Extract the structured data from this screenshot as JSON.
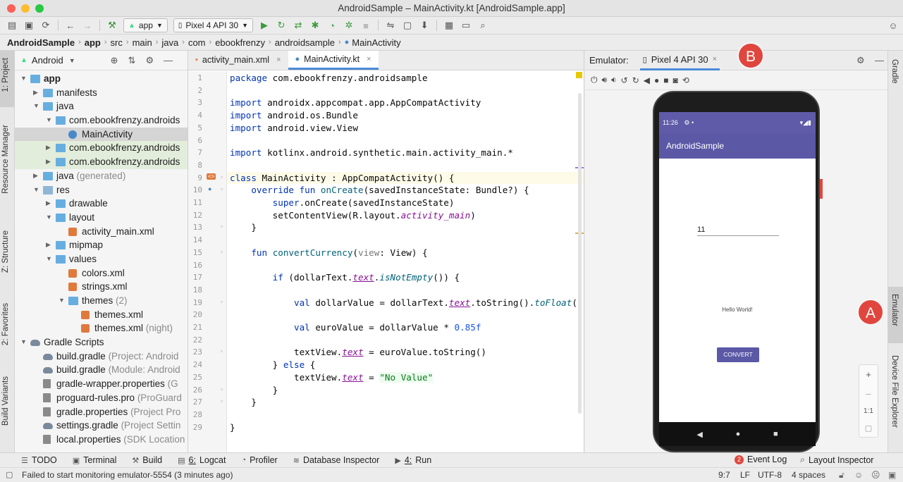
{
  "window": {
    "title": "AndroidSample – MainActivity.kt [AndroidSample.app]"
  },
  "toolbar": {
    "run_config": "app",
    "device": "Pixel 4 API 30",
    "icons": [
      "open-icon",
      "save-icon",
      "sync-icon",
      "back-icon",
      "forward-icon",
      "build-icon",
      "run-icon",
      "apply-changes-icon",
      "apply-code-changes-icon",
      "debug-icon",
      "profile-icon",
      "attach-debugger-icon",
      "stop-icon",
      "gradle-sync-icon",
      "avd-manager-icon",
      "sdk-manager-icon",
      "project-structure-icon",
      "search-icon",
      "user-icon"
    ]
  },
  "breadcrumbs": [
    "AndroidSample",
    "app",
    "src",
    "main",
    "java",
    "com",
    "ebookfrenzy",
    "androidsample",
    "MainActivity"
  ],
  "left_strip": [
    "1: Project",
    "Resource Manager",
    "Z: Structure",
    "2: Favorites",
    "Build Variants"
  ],
  "right_strip": [
    "Gradle",
    "Emulator",
    "Device File Explorer"
  ],
  "project": {
    "view": "Android",
    "tree": [
      {
        "label": "app",
        "extra": "",
        "depth": 0,
        "icon": "folder",
        "open": true
      },
      {
        "label": "manifests",
        "extra": "",
        "depth": 1,
        "icon": "folder",
        "open": false
      },
      {
        "label": "java",
        "extra": "",
        "depth": 1,
        "icon": "folder",
        "open": true
      },
      {
        "label": "com.ebookfrenzy.androids",
        "extra": "",
        "depth": 2,
        "icon": "folder",
        "open": true
      },
      {
        "label": "MainActivity",
        "extra": "",
        "depth": 3,
        "icon": "kotlin",
        "open": null
      },
      {
        "label": "com.ebookfrenzy.androids",
        "extra": "",
        "depth": 2,
        "icon": "folder",
        "open": false
      },
      {
        "label": "com.ebookfrenzy.androids",
        "extra": "",
        "depth": 2,
        "icon": "folder",
        "open": false
      },
      {
        "label": "java",
        "extra": "(generated)",
        "depth": 1,
        "icon": "folder",
        "open": false
      },
      {
        "label": "res",
        "extra": "",
        "depth": 1,
        "icon": "res",
        "open": true
      },
      {
        "label": "drawable",
        "extra": "",
        "depth": 2,
        "icon": "folder",
        "open": false
      },
      {
        "label": "layout",
        "extra": "",
        "depth": 2,
        "icon": "folder",
        "open": true
      },
      {
        "label": "activity_main.xml",
        "extra": "",
        "depth": 3,
        "icon": "xml",
        "open": null
      },
      {
        "label": "mipmap",
        "extra": "",
        "depth": 2,
        "icon": "folder",
        "open": false
      },
      {
        "label": "values",
        "extra": "",
        "depth": 2,
        "icon": "folder",
        "open": true
      },
      {
        "label": "colors.xml",
        "extra": "",
        "depth": 3,
        "icon": "xml",
        "open": null
      },
      {
        "label": "strings.xml",
        "extra": "",
        "depth": 3,
        "icon": "xml",
        "open": null
      },
      {
        "label": "themes",
        "extra": "(2)",
        "depth": 3,
        "icon": "folder",
        "open": true
      },
      {
        "label": "themes.xml",
        "extra": "",
        "depth": 4,
        "icon": "xml",
        "open": null
      },
      {
        "label": "themes.xml",
        "extra": "(night)",
        "depth": 4,
        "icon": "xml",
        "open": null
      },
      {
        "label": "Gradle Scripts",
        "extra": "",
        "depth": 0,
        "icon": "gradle",
        "open": true
      },
      {
        "label": "build.gradle",
        "extra": "(Project: Android",
        "depth": 1,
        "icon": "gradle",
        "open": null
      },
      {
        "label": "build.gradle",
        "extra": "(Module: Android",
        "depth": 1,
        "icon": "gradle",
        "open": null
      },
      {
        "label": "gradle-wrapper.properties",
        "extra": "(G",
        "depth": 1,
        "icon": "prop",
        "open": null
      },
      {
        "label": "proguard-rules.pro",
        "extra": "(ProGuard",
        "depth": 1,
        "icon": "prop",
        "open": null
      },
      {
        "label": "gradle.properties",
        "extra": "(Project Pro",
        "depth": 1,
        "icon": "prop",
        "open": null
      },
      {
        "label": "settings.gradle",
        "extra": "(Project Settin",
        "depth": 1,
        "icon": "gradle",
        "open": null
      },
      {
        "label": "local.properties",
        "extra": "(SDK Location",
        "depth": 1,
        "icon": "prop",
        "open": null
      }
    ]
  },
  "editor": {
    "tabs": [
      {
        "label": "activity_main.xml",
        "close": "×",
        "active": false
      },
      {
        "label": "MainActivity.kt",
        "close": "×",
        "active": true
      }
    ],
    "line_numbers": [
      "1",
      "2",
      "3",
      "4",
      "5",
      "6",
      "7",
      "8",
      "9",
      "10",
      "11",
      "12",
      "13",
      "14",
      "15",
      "16",
      "17",
      "18",
      "19",
      "20",
      "21",
      "22",
      "23",
      "24",
      "25",
      "26",
      "27",
      "28",
      "29"
    ],
    "lines": [
      [
        [
          "kw",
          "package "
        ],
        [
          "",
          "com.ebookfrenzy.androidsample"
        ]
      ],
      [],
      [
        [
          "kw",
          "import "
        ],
        [
          "",
          "androidx.appcompat.app.AppCompatActivity"
        ]
      ],
      [
        [
          "kw",
          "import "
        ],
        [
          "",
          "android.os.Bundle"
        ]
      ],
      [
        [
          "kw",
          "import "
        ],
        [
          "",
          "android.view.View"
        ]
      ],
      [],
      [
        [
          "kw",
          "import "
        ],
        [
          "",
          "kotlinx.android.synthetic.main.activity_main.*"
        ]
      ],
      [],
      [
        [
          "kw",
          "class "
        ],
        [
          "",
          "MainActivity : AppCompatActivity() {"
        ]
      ],
      [
        [
          "",
          "    "
        ],
        [
          "kw",
          "override fun "
        ],
        [
          "fnd",
          "onCreate"
        ],
        [
          "",
          "(savedInstanceState: Bundle?) {"
        ]
      ],
      [
        [
          "",
          "        "
        ],
        [
          "kw",
          "super"
        ],
        [
          "",
          ".onCreate(savedInstanceState)"
        ]
      ],
      [
        [
          "",
          "        setContentView(R.layout."
        ],
        [
          "prop it",
          "activity_main"
        ],
        [
          "",
          ")"
        ]
      ],
      [
        [
          "",
          "    }"
        ]
      ],
      [],
      [
        [
          "",
          "    "
        ],
        [
          "kw",
          "fun "
        ],
        [
          "fnd",
          "convertCurrency"
        ],
        [
          "",
          "("
        ],
        [
          "par",
          "view"
        ],
        [
          "",
          ": View) {"
        ]
      ],
      [],
      [
        [
          "",
          "        "
        ],
        [
          "kw",
          "if "
        ],
        [
          "",
          "(dollarText."
        ],
        [
          "prop it und",
          "text"
        ],
        [
          "",
          "."
        ],
        [
          "fnd it",
          "isNotEmpty"
        ],
        [
          "",
          "()) {"
        ]
      ],
      [],
      [
        [
          "",
          "            "
        ],
        [
          "kw",
          "val "
        ],
        [
          "",
          "dollarValue = dollarText."
        ],
        [
          "prop it und",
          "text"
        ],
        [
          "",
          ".toString()."
        ],
        [
          "fnd it",
          "toFloat"
        ],
        [
          "",
          "()"
        ]
      ],
      [],
      [
        [
          "",
          "            "
        ],
        [
          "kw",
          "val "
        ],
        [
          "",
          "euroValue = dollarValue * "
        ],
        [
          "num",
          "0.85f"
        ]
      ],
      [],
      [
        [
          "",
          "            textView."
        ],
        [
          "prop it und",
          "text"
        ],
        [
          "",
          " = euroValue.toString()"
        ]
      ],
      [
        [
          "",
          "        } "
        ],
        [
          "kw",
          "else "
        ],
        [
          "",
          "{"
        ]
      ],
      [
        [
          "",
          "            textView."
        ],
        [
          "prop it und",
          "text"
        ],
        [
          "",
          " = "
        ],
        [
          "str",
          "\"No Value\""
        ]
      ],
      [
        [
          "",
          "        }"
        ]
      ],
      [
        [
          "",
          "    }"
        ]
      ],
      [],
      [
        [
          "",
          "}"
        ]
      ]
    ]
  },
  "emulator": {
    "label": "Emulator:",
    "device_tab": "Pixel 4 API 30",
    "close": "×",
    "time": "11:26",
    "app_title": "AndroidSample",
    "input_value": "11",
    "hello_text": "Hello World!",
    "button_label": "CONVERT",
    "zoom_in": "+",
    "zoom_out": "–",
    "zoom_actual": "1:1"
  },
  "callouts": {
    "a": "A",
    "b": "B"
  },
  "bottom_tools": [
    {
      "label": "TODO",
      "prefix": ""
    },
    {
      "label": "Terminal",
      "prefix": ""
    },
    {
      "label": "Build",
      "prefix": ""
    },
    {
      "label": "Logcat",
      "prefix": "6:"
    },
    {
      "label": "Profiler",
      "prefix": ""
    },
    {
      "label": "Database Inspector",
      "prefix": ""
    },
    {
      "label": "Run",
      "prefix": "4:"
    }
  ],
  "bottom_right": {
    "event_log": "Event Log",
    "event_count": "2",
    "layout_inspector": "Layout Inspector"
  },
  "status": {
    "message": "Failed to start monitoring emulator-5554 (3 minutes ago)",
    "position": "9:7",
    "line_sep": "LF",
    "encoding": "UTF-8",
    "indent": "4 spaces"
  },
  "colors": {
    "accent": "#4a8ad8",
    "appbar": "#5b58a6",
    "callout": "#e0463e",
    "button": "#5b58a6"
  }
}
